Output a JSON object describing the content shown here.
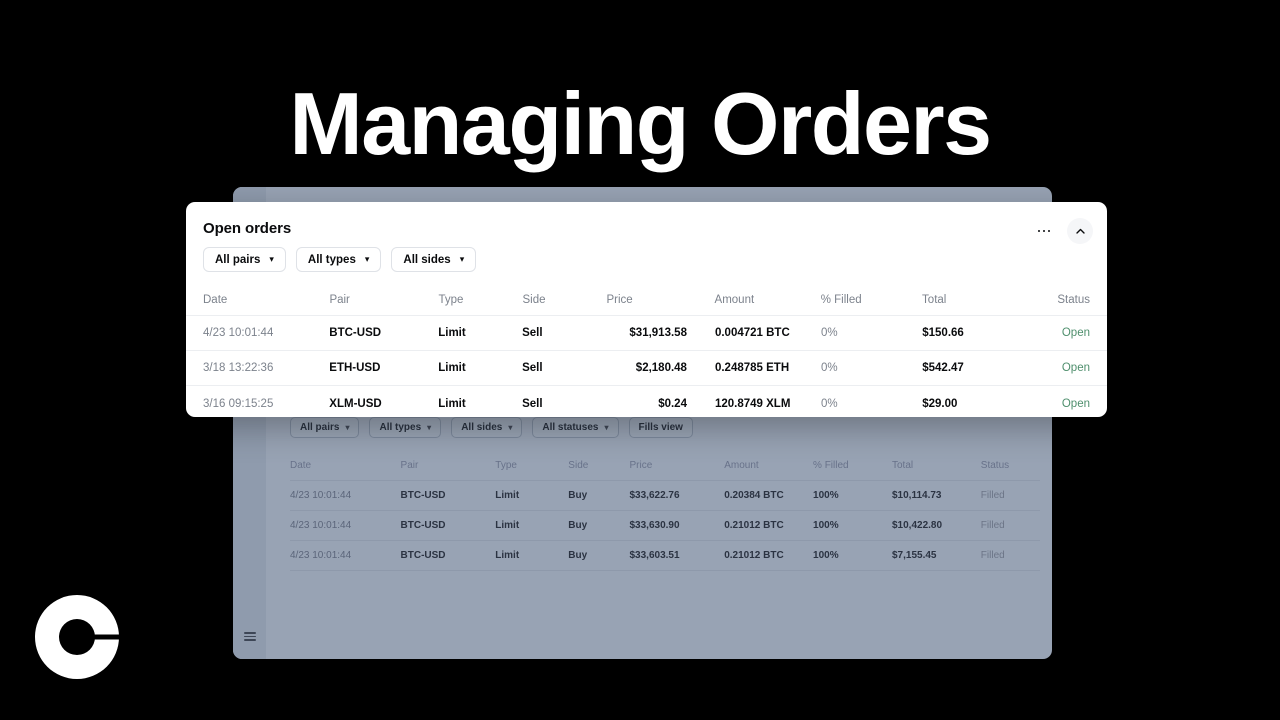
{
  "headline": "Managing Orders",
  "brand": {
    "logo_name": "coinbase-logo"
  },
  "card": {
    "title": "Open orders",
    "menu_icon": "more-horizontal-icon",
    "collapse_icon": "chevron-up-icon",
    "filters": [
      {
        "label": "All pairs"
      },
      {
        "label": "All types"
      },
      {
        "label": "All sides"
      }
    ],
    "columns": [
      "Date",
      "Pair",
      "Type",
      "Side",
      "Price",
      "Amount",
      "% Filled",
      "Total",
      "Status"
    ],
    "rows": [
      {
        "date": "4/23 10:01:44",
        "pair": "BTC-USD",
        "type": "Limit",
        "side": "Sell",
        "price": "$31,913.58",
        "amount": "0.004721 BTC",
        "filled": "0%",
        "total": "$150.66",
        "status": "Open"
      },
      {
        "date": "3/18 13:22:36",
        "pair": "ETH-USD",
        "type": "Limit",
        "side": "Sell",
        "price": "$2,180.48",
        "amount": "0.248785 ETH",
        "filled": "0%",
        "total": "$542.47",
        "status": "Open"
      },
      {
        "date": "3/16 09:15:25",
        "pair": "XLM-USD",
        "type": "Limit",
        "side": "Sell",
        "price": "$0.24",
        "amount": "120.8749 XLM",
        "filled": "0%",
        "total": "$29.00",
        "status": "Open"
      }
    ],
    "status_color": "#4f8f6d"
  },
  "background_window": {
    "menu_icon": "hamburger-menu-icon",
    "filters": [
      {
        "label": "All pairs",
        "has_chevron": true
      },
      {
        "label": "All types",
        "has_chevron": true
      },
      {
        "label": "All sides",
        "has_chevron": true
      },
      {
        "label": "All statuses",
        "has_chevron": true
      },
      {
        "label": "Fills view",
        "has_chevron": false
      }
    ],
    "columns": [
      "Date",
      "Pair",
      "Type",
      "Side",
      "Price",
      "Amount",
      "% Filled",
      "Total",
      "Status"
    ],
    "rows": [
      {
        "date": "4/23 10:01:44",
        "pair": "BTC-USD",
        "type": "Limit",
        "side": "Buy",
        "price": "$33,622.76",
        "amount": "0.20384 BTC",
        "filled": "100%",
        "total": "$10,114.73",
        "status": "Filled"
      },
      {
        "date": "4/23 10:01:44",
        "pair": "BTC-USD",
        "type": "Limit",
        "side": "Buy",
        "price": "$33,630.90",
        "amount": "0.21012 BTC",
        "filled": "100%",
        "total": "$10,422.80",
        "status": "Filled"
      },
      {
        "date": "4/23 10:01:44",
        "pair": "BTC-USD",
        "type": "Limit",
        "side": "Buy",
        "price": "$33,603.51",
        "amount": "0.21012 BTC",
        "filled": "100%",
        "total": "$7,155.45",
        "status": "Filled"
      }
    ]
  },
  "colors": {
    "background": "#000000",
    "card_bg": "#ffffff",
    "window_bg": "#98a3b4",
    "sidebar_bg": "#8f9bad",
    "accent_green": "#4f8f6d"
  }
}
